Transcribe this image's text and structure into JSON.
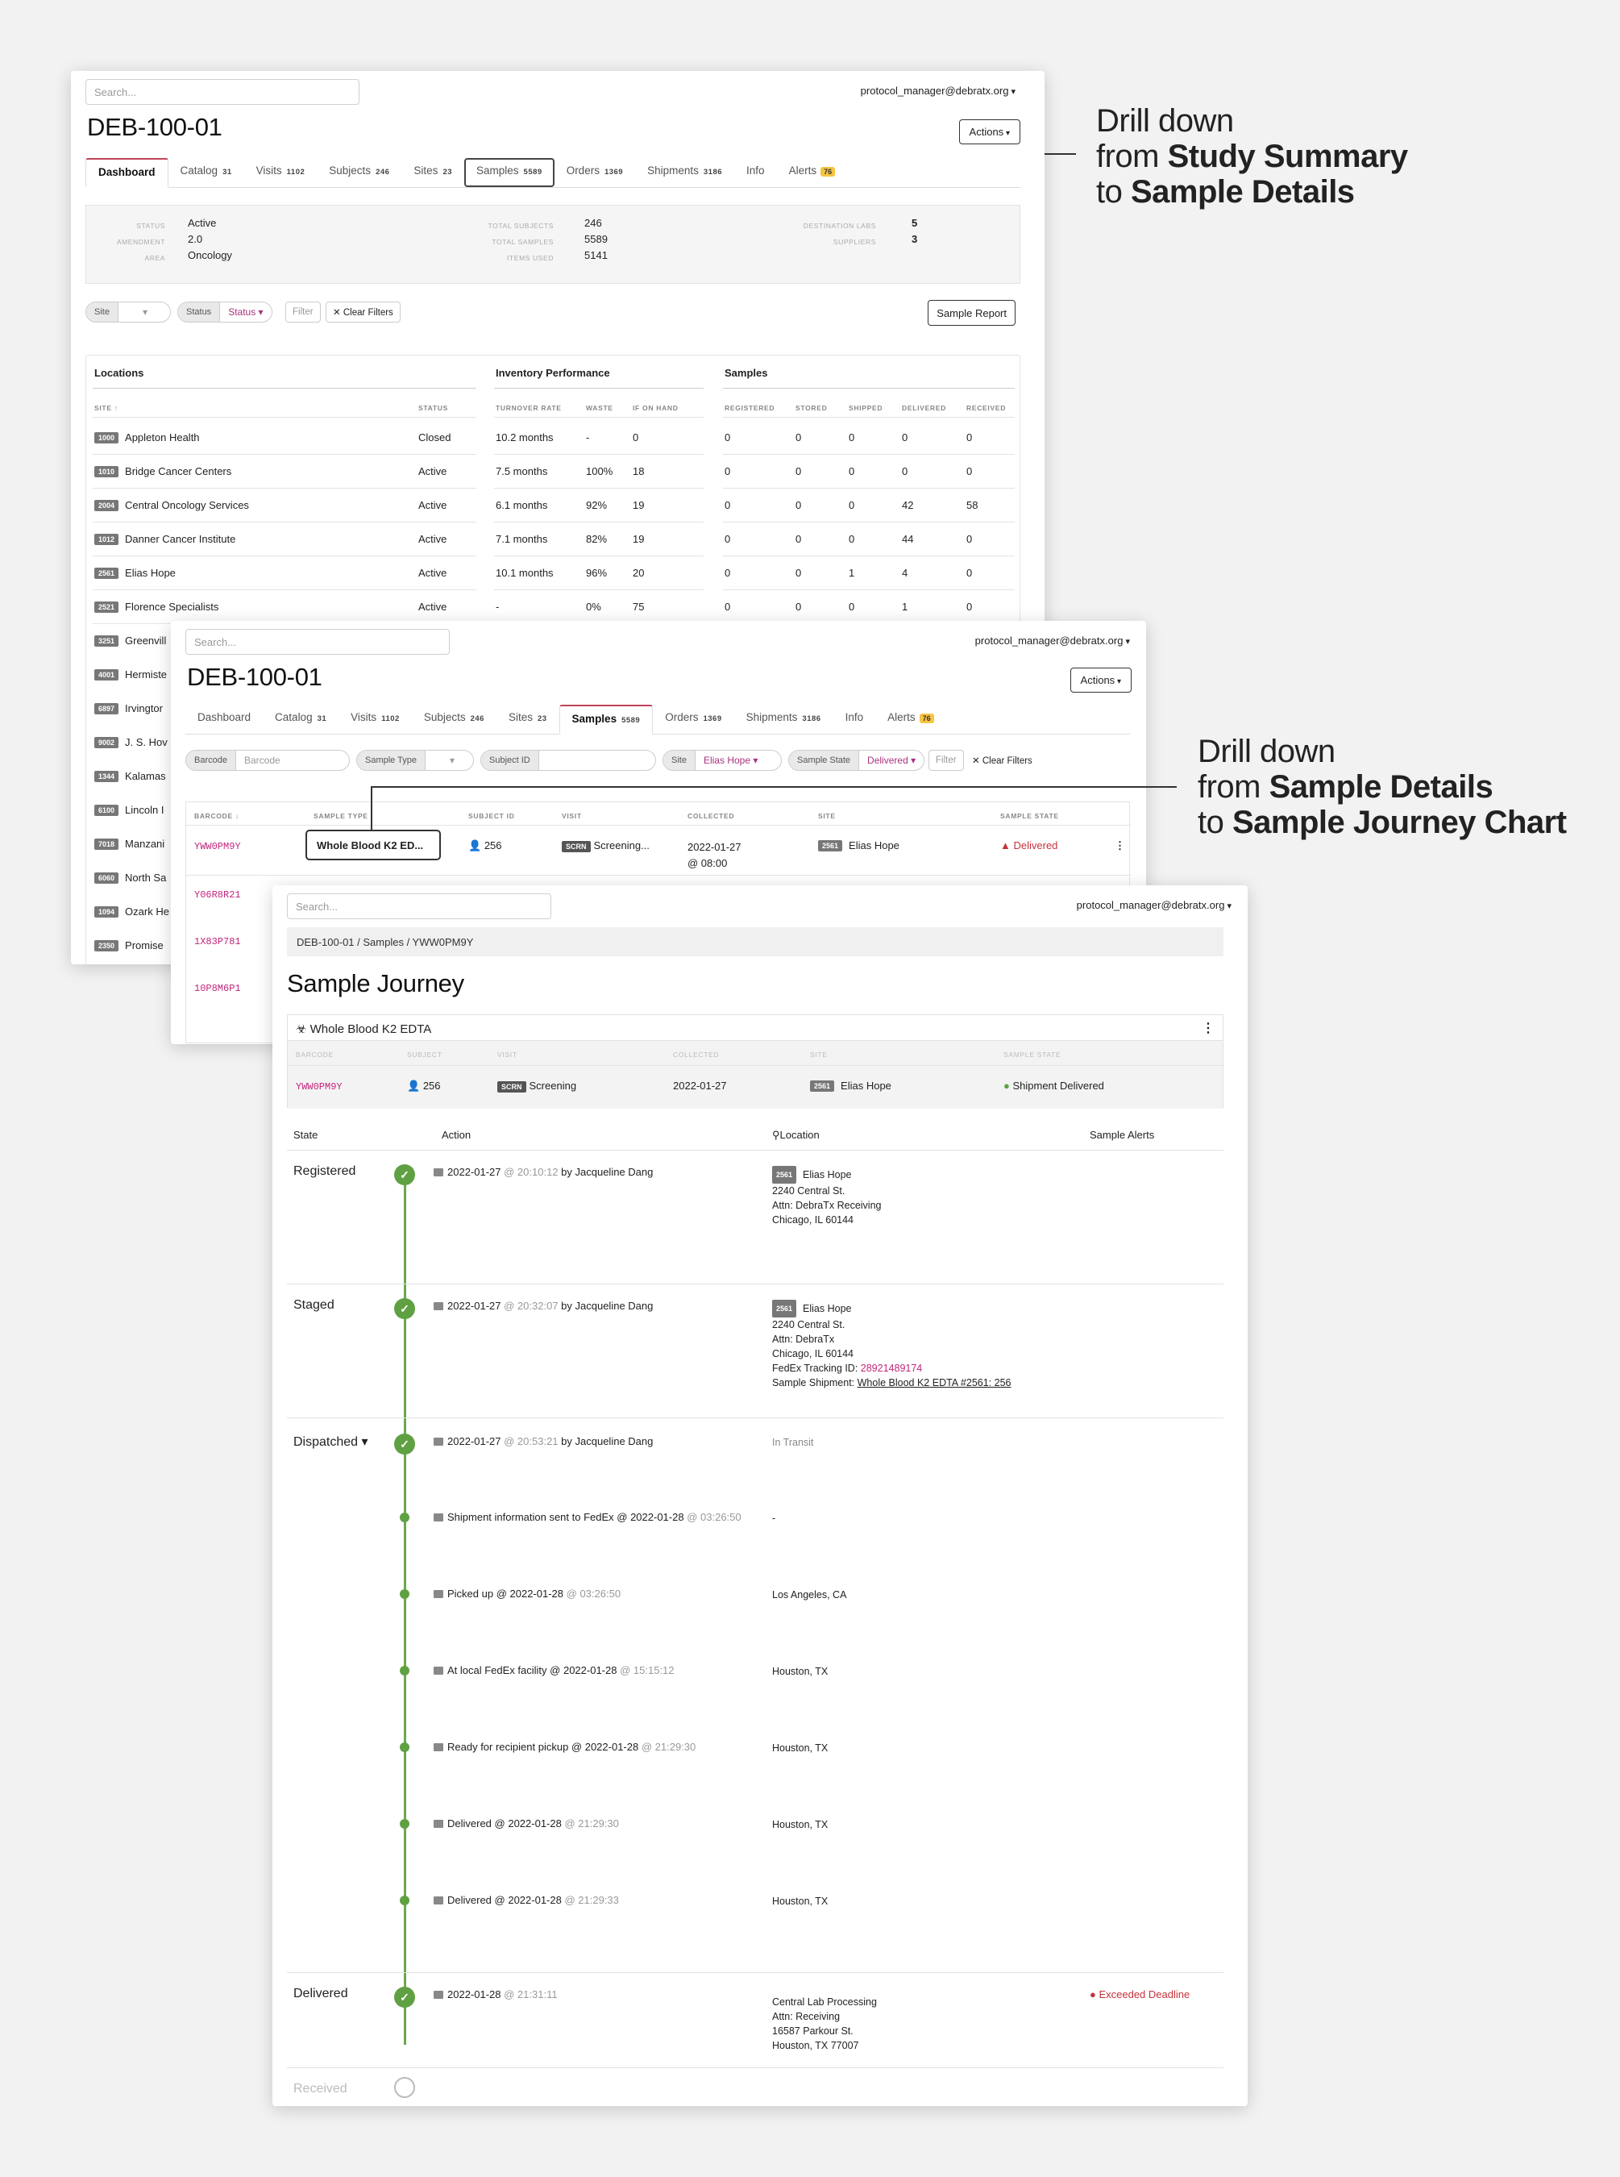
{
  "user": "protocol_manager@debratx.org",
  "search_placeholder": "Search...",
  "study": "DEB-100-01",
  "actions": "Actions",
  "tabs": [
    {
      "label": "Dashboard",
      "count": ""
    },
    {
      "label": "Catalog",
      "count": "31"
    },
    {
      "label": "Visits",
      "count": "1102"
    },
    {
      "label": "Subjects",
      "count": "246"
    },
    {
      "label": "Sites",
      "count": "23"
    },
    {
      "label": "Samples",
      "count": "5589"
    },
    {
      "label": "Orders",
      "count": "1369"
    },
    {
      "label": "Shipments",
      "count": "3186"
    },
    {
      "label": "Info",
      "count": ""
    },
    {
      "label": "Alerts",
      "count": "76"
    }
  ],
  "summary": {
    "status_label": "STATUS",
    "status": "Active",
    "amendment_label": "AMENDMENT",
    "amendment": "2.0",
    "area_label": "AREA",
    "area": "Oncology",
    "total_subjects_label": "TOTAL SUBJECTS",
    "total_subjects": "246",
    "total_samples_label": "TOTAL SAMPLES",
    "total_samples": "5589",
    "items_used_label": "ITEMS USED",
    "items_used": "5141",
    "dest_labs_label": "DESTINATION LABS",
    "dest_labs": "5",
    "suppliers_label": "SUPPLIERS",
    "suppliers": "3"
  },
  "filters1": {
    "site": "Site",
    "status": "Status",
    "status_value": "Status",
    "filter": "Filter",
    "clear": "✕ Clear Filters",
    "report": "Sample Report"
  },
  "dash": {
    "sections": {
      "locations": "Locations",
      "inventory": "Inventory Performance",
      "samples": "Samples"
    },
    "cols": {
      "site": "SITE ↑",
      "status": "STATUS",
      "turnover": "TURNOVER RATE",
      "waste": "WASTE",
      "ifonhand": "IF ON HAND",
      "registered": "REGISTERED",
      "stored": "STORED",
      "shipped": "SHIPPED",
      "delivered": "DELIVERED",
      "received": "RECEIVED"
    },
    "rows": [
      {
        "id": "1000",
        "name": "Appleton Health",
        "status": "Closed",
        "turnover": "10.2 months",
        "waste": "-",
        "onhand": "0",
        "reg": "0",
        "sto": "0",
        "shp": "0",
        "del": "0",
        "rec": "0"
      },
      {
        "id": "1010",
        "name": "Bridge Cancer Centers",
        "status": "Active",
        "turnover": "7.5 months",
        "waste": "100%",
        "onhand": "18",
        "reg": "0",
        "sto": "0",
        "shp": "0",
        "del": "0",
        "rec": "0"
      },
      {
        "id": "2004",
        "name": "Central Oncology Services",
        "status": "Active",
        "turnover": "6.1 months",
        "waste": "92%",
        "onhand": "19",
        "reg": "0",
        "sto": "0",
        "shp": "0",
        "del": "42",
        "rec": "58"
      },
      {
        "id": "1012",
        "name": "Danner Cancer Institute",
        "status": "Active",
        "turnover": "7.1 months",
        "waste": "82%",
        "onhand": "19",
        "reg": "0",
        "sto": "0",
        "shp": "0",
        "del": "44",
        "rec": "0"
      },
      {
        "id": "2561",
        "name": "Elias Hope",
        "status": "Active",
        "turnover": "10.1 months",
        "waste": "96%",
        "onhand": "20",
        "reg": "0",
        "sto": "0",
        "shp": "1",
        "del": "4",
        "rec": "0"
      },
      {
        "id": "2521",
        "name": "Florence Specialists",
        "status": "Active",
        "turnover": "-",
        "waste": "0%",
        "onhand": "75",
        "reg": "0",
        "sto": "0",
        "shp": "0",
        "del": "1",
        "rec": "0"
      }
    ],
    "hidden_rows": [
      {
        "id": "3251",
        "name": "Greenvill"
      },
      {
        "id": "4001",
        "name": "Hermiste"
      },
      {
        "id": "6897",
        "name": "Irvingtor"
      },
      {
        "id": "9002",
        "name": "J. S. Hov"
      },
      {
        "id": "1344",
        "name": "Kalamas"
      },
      {
        "id": "6100",
        "name": "Lincoln I"
      },
      {
        "id": "7018",
        "name": "Manzani"
      },
      {
        "id": "6060",
        "name": "North Sa"
      },
      {
        "id": "1094",
        "name": "Ozark He"
      },
      {
        "id": "2350",
        "name": "Promise"
      }
    ]
  },
  "filters2": {
    "barcode_label": "Barcode",
    "barcode_placeholder": "Barcode",
    "type_label": "Sample Type",
    "subject_label": "Subject ID",
    "site_label": "Site",
    "site_value": "Elias Hope",
    "state_label": "Sample State",
    "state_value": "Delivered",
    "filter": "Filter",
    "clear": "✕ Clear Filters"
  },
  "samples_table": {
    "cols": {
      "barcode": "BARCODE ↓",
      "type": "SAMPLE TYPE",
      "subject": "SUBJECT ID",
      "visit": "VISIT",
      "collected": "COLLECTED",
      "site": "SITE",
      "state": "SAMPLE STATE"
    },
    "row": {
      "barcode": "YWW0PM9Y",
      "type": "Whole Blood K2 ED...",
      "subject": "256",
      "visit_tag": "SCRN",
      "visit": "Screening...",
      "collected": "2022-01-27",
      "collected_time": "@ 08:00",
      "site_id": "2561",
      "site": "Elias Hope",
      "state": "Delivered",
      "more": "⋮"
    },
    "other_barcodes": [
      "Y06R8R21",
      "1X83P781",
      "10P8M6P1"
    ]
  },
  "journey": {
    "breadcrumb": "DEB-100-01 / Samples / YWW0PM9Y",
    "title": "Sample Journey",
    "sample_type": "Whole Blood K2 EDTA",
    "card_cols": {
      "barcode": "BARCODE",
      "subject": "SUBJECT",
      "visit": "VISIT",
      "collected": "COLLECTED",
      "site": "SITE",
      "state": "SAMPLE STATE"
    },
    "card_row": {
      "barcode": "YWW0PM9Y",
      "subject": "256",
      "visit_tag": "SCRN",
      "visit": "Screening",
      "collected": "2022-01-27",
      "site_id": "2561",
      "site": "Elias Hope",
      "state": "Shipment Delivered"
    },
    "headers": {
      "state": "State",
      "action": "Action",
      "location": "Location",
      "alerts": "Sample Alerts"
    },
    "steps": [
      {
        "state": "Registered",
        "date": "2022-01-27",
        "time": "@ 20:10:12",
        "by": "by Jacqueline Dang",
        "loc_id": "2561",
        "loc_name": "Elias Hope",
        "lines": [
          "2240 Central St.",
          "Attn: DebraTx Receiving",
          "Chicago, IL 60144"
        ]
      },
      {
        "state": "Staged",
        "date": "2022-01-27",
        "time": "@ 20:32:07",
        "by": "by Jacqueline Dang",
        "loc_id": "2561",
        "loc_name": "Elias Hope",
        "lines": [
          "2240 Central St.",
          "Attn: DebraTx",
          "Chicago, IL 60144"
        ],
        "fedex_label": "FedEx Tracking ID:",
        "fedex": "28921489174",
        "shipment_label": "Sample Shipment:",
        "shipment": "Whole Blood K2 EDTA #2561: 256"
      },
      {
        "state": "Dispatched ▾",
        "date": "2022-01-27",
        "time": "@ 20:53:21",
        "by": "by Jacqueline Dang",
        "loc": "In Transit"
      }
    ],
    "events": [
      {
        "text": "Shipment information sent to FedEx @ 2022-01-28",
        "time": "@ 03:26:50",
        "loc": "-"
      },
      {
        "text": "Picked up @ 2022-01-28",
        "time": "@ 03:26:50",
        "loc": "Los Angeles, CA"
      },
      {
        "text": "At local FedEx facility @ 2022-01-28",
        "time": "@ 15:15:12",
        "loc": "Houston, TX"
      },
      {
        "text": "Ready for recipient pickup @ 2022-01-28",
        "time": "@ 21:29:30",
        "loc": "Houston, TX"
      },
      {
        "text": "Delivered @ 2022-01-28",
        "time": "@ 21:29:30",
        "loc": "Houston, TX"
      },
      {
        "text": "Delivered @ 2022-01-28",
        "time": "@ 21:29:33",
        "loc": "Houston, TX"
      }
    ],
    "delivered": {
      "state": "Delivered",
      "date": "2022-01-28",
      "time": "@ 21:31:11",
      "lines": [
        "Central Lab Processing",
        "Attn: Receiving",
        "16587 Parkour St.",
        "Houston, TX 77007"
      ],
      "alert": "Exceeded Deadline"
    },
    "received": "Received"
  },
  "annotations": {
    "a1": [
      "Drill down",
      "from ",
      "Study Summary",
      "to ",
      "Sample Details"
    ],
    "a2": [
      "Drill down",
      "from ",
      "Sample Details",
      "to ",
      "Sample Journey Chart"
    ]
  }
}
